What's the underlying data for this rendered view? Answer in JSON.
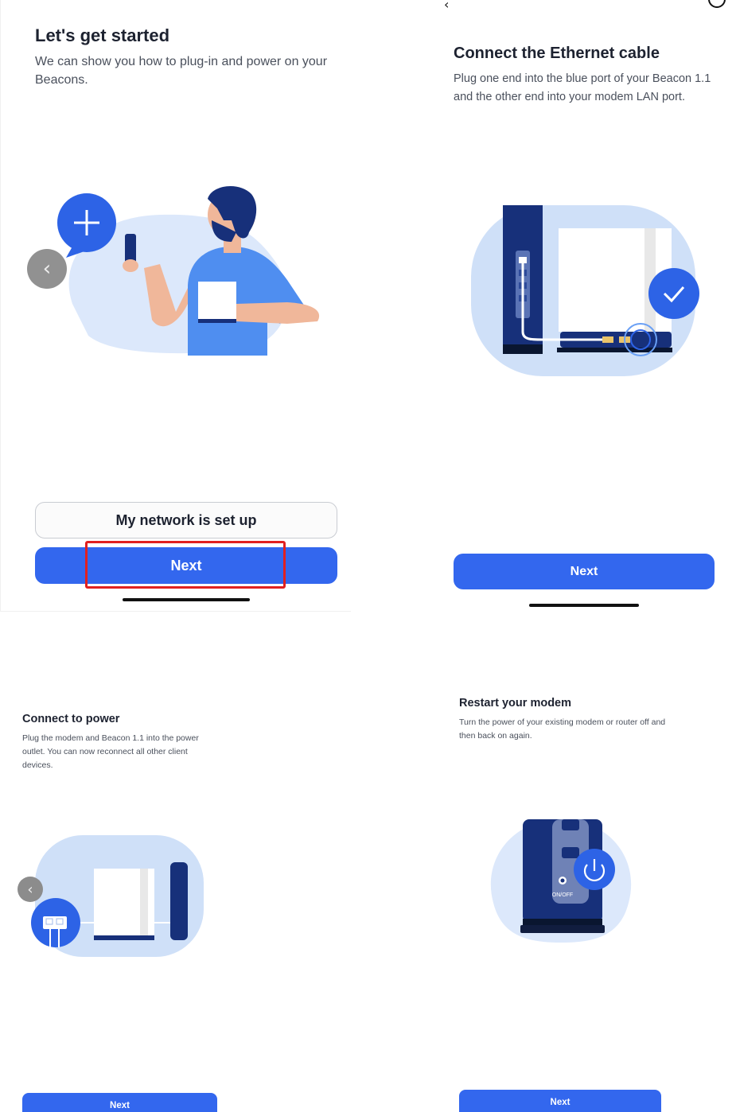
{
  "colors": {
    "primary": "#3367ee",
    "navy": "#17307a",
    "light_blue": "#c8dbf7",
    "highlight": "#e02020"
  },
  "screen1": {
    "title": "Let's get started",
    "description": "We can show you how to plug-in and power on your Beacons.",
    "secondary_button": "My network is set up",
    "next_button": "Next",
    "back_icon": "chevron-left-icon"
  },
  "screen2": {
    "title": "Connect the Ethernet cable",
    "description": "Plug one end into the blue port of your Beacon 1.1 and the other end into your modem LAN port.",
    "next_button": "Next"
  },
  "screen3": {
    "title": "Connect to power",
    "description": "Plug the modem and Beacon 1.1 into the power outlet. You can now reconnect all other client devices.",
    "next_button": "Next"
  },
  "screen4": {
    "title": "Restart your modem",
    "description": "Turn the power of your existing modem or router off and then back on again.",
    "switch_label": "ON/OFF",
    "next_button": "Next"
  }
}
